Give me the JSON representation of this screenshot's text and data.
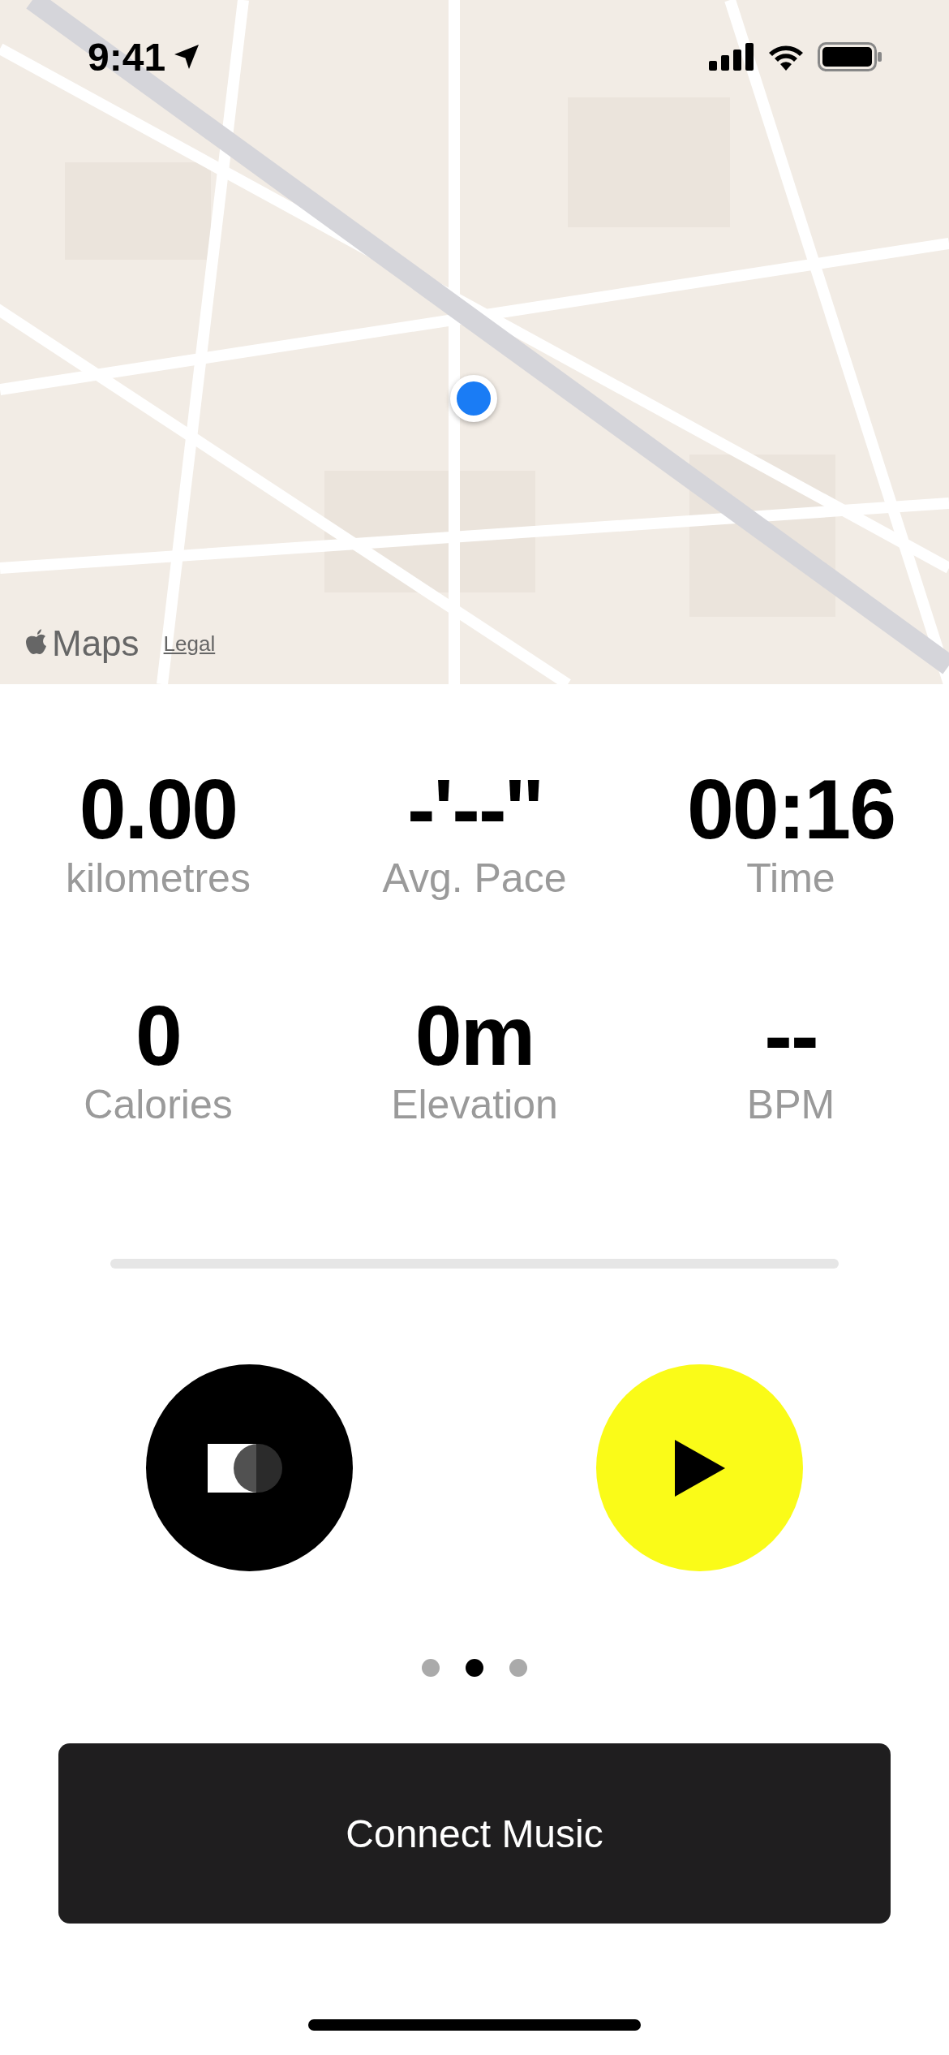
{
  "status_bar": {
    "time": "9:41"
  },
  "map": {
    "kind": "picture",
    "attribution": "Maps",
    "legal_link": "Legal"
  },
  "stats": [
    {
      "value": "0.00",
      "label": "kilometres"
    },
    {
      "value": "-'--''",
      "label": "Avg. Pace"
    },
    {
      "value": "00:16",
      "label": "Time"
    },
    {
      "value": "0",
      "label": "Calories"
    },
    {
      "value": "0m",
      "label": "Elevation"
    },
    {
      "value": "--",
      "label": "BPM"
    }
  ],
  "progress": {
    "level": 0
  },
  "page_dots": [
    {
      "selected": false
    },
    {
      "selected": true
    },
    {
      "selected": false
    }
  ],
  "connect_button": {
    "label": "Connect Music"
  }
}
